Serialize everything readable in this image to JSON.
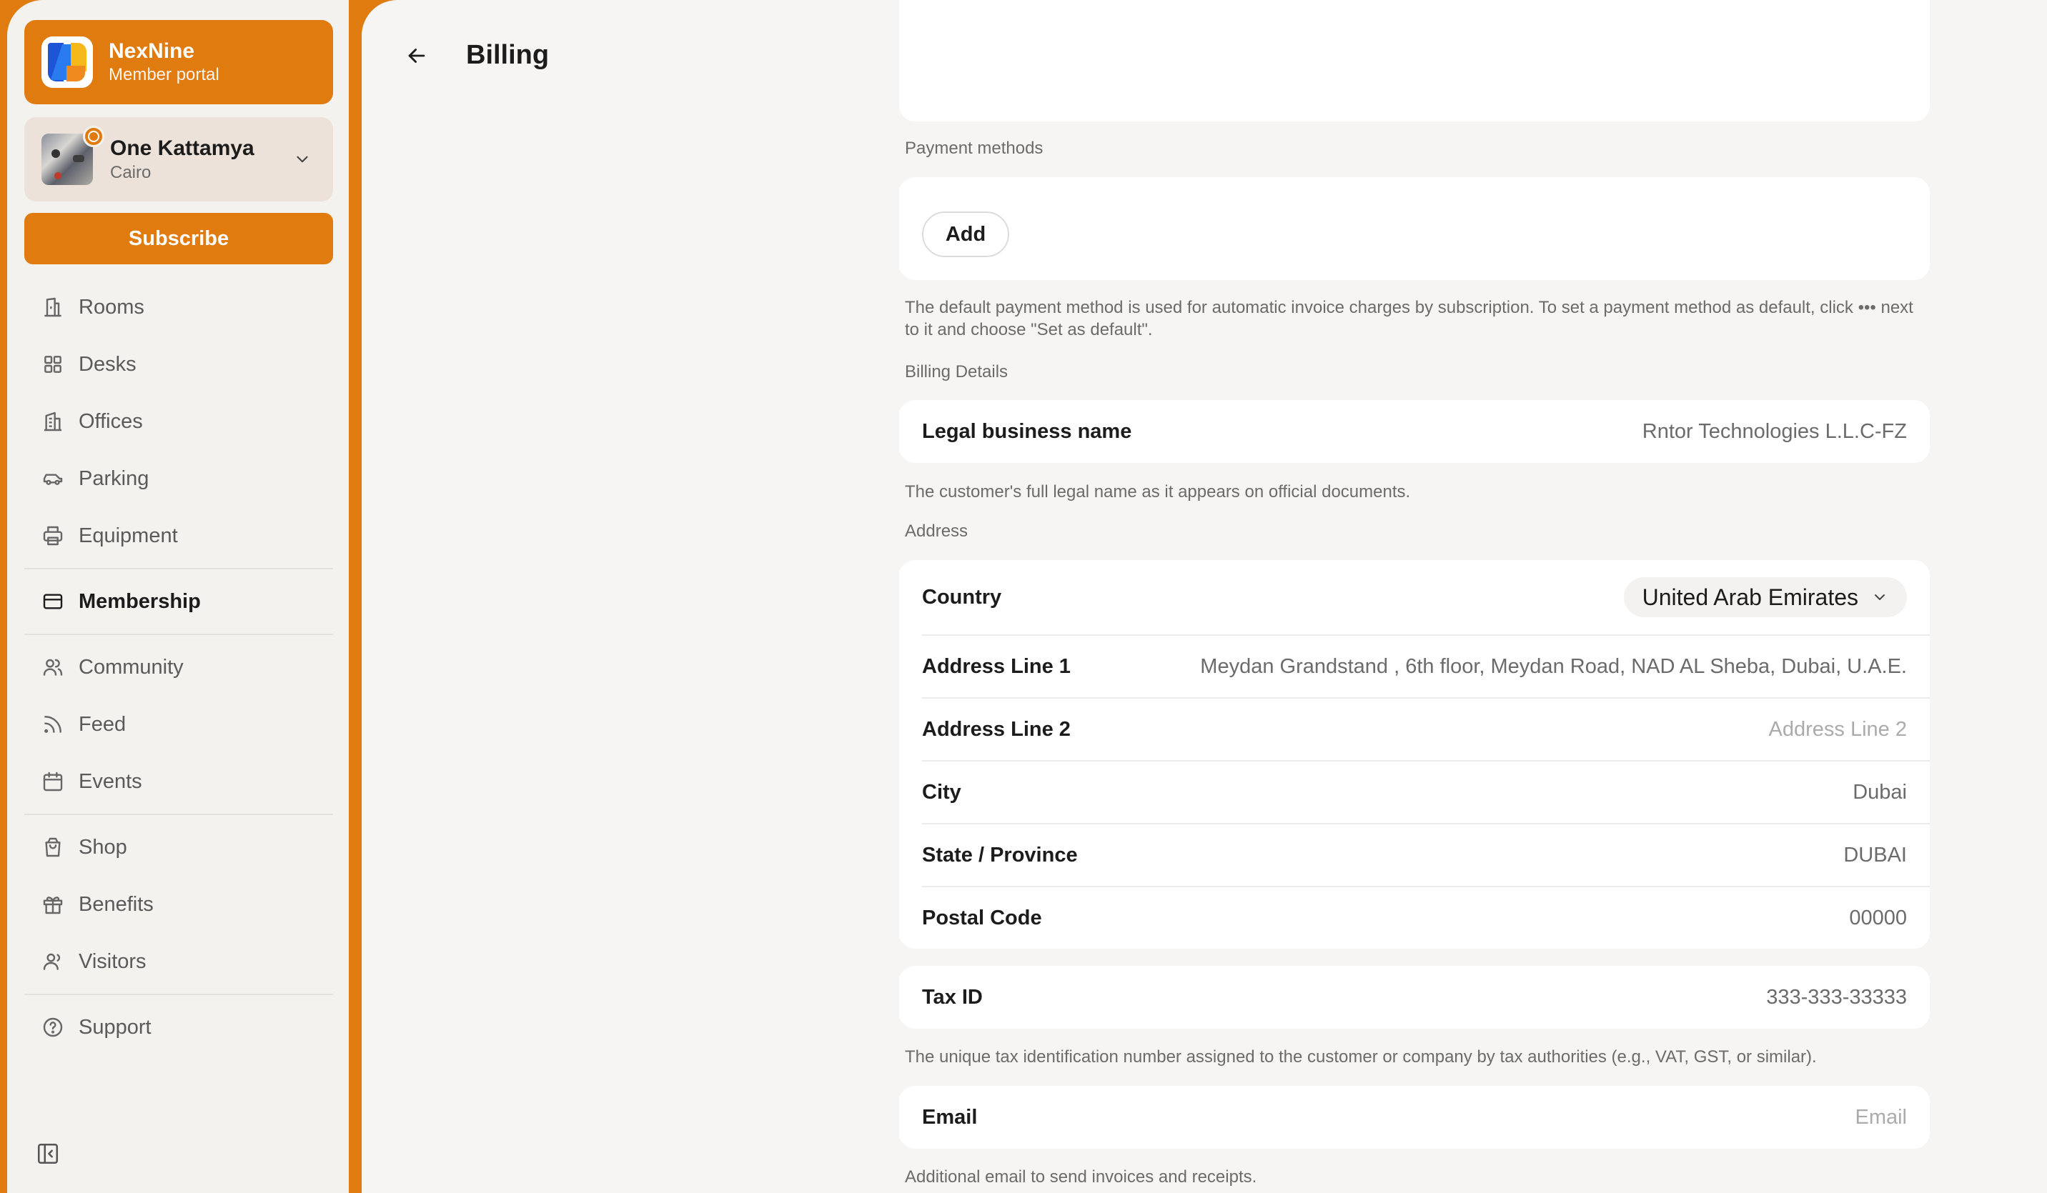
{
  "brand": {
    "name": "NexNine",
    "subtitle": "Member portal"
  },
  "location": {
    "name": "One Kattamya",
    "city": "Cairo"
  },
  "subscribe_label": "Subscribe",
  "nav": {
    "rooms": "Rooms",
    "desks": "Desks",
    "offices": "Offices",
    "parking": "Parking",
    "equipment": "Equipment",
    "membership": "Membership",
    "community": "Community",
    "feed": "Feed",
    "events": "Events",
    "shop": "Shop",
    "benefits": "Benefits",
    "visitors": "Visitors",
    "support": "Support"
  },
  "page": {
    "title": "Billing"
  },
  "payment": {
    "section_label": "Payment methods",
    "add_label": "Add",
    "help": "The default payment method is used for automatic invoice charges by subscription. To set a payment method as default, click ••• next to it and choose \"Set as default\"."
  },
  "billing": {
    "section_label": "Billing Details",
    "legal_label": "Legal business name",
    "legal_value": "Rntor Technologies L.L.C-FZ",
    "legal_help": "The customer's full legal name as it appears on official documents."
  },
  "address": {
    "section_label": "Address",
    "country_label": "Country",
    "country_value": "United Arab Emirates",
    "line1_label": "Address Line 1",
    "line1_value": "Meydan Grandstand , 6th floor, Meydan Road, NAD AL Sheba, Dubai, U.A.E.",
    "line2_label": "Address Line 2",
    "line2_placeholder": "Address Line 2",
    "city_label": "City",
    "city_value": "Dubai",
    "state_label": "State / Province",
    "state_value": "DUBAI",
    "postal_label": "Postal Code",
    "postal_value": "00000"
  },
  "tax": {
    "label": "Tax ID",
    "value": "333-333-33333",
    "help": "The unique tax identification number assigned to the customer or company by tax authorities (e.g., VAT, GST, or similar)."
  },
  "email": {
    "label": "Email",
    "placeholder": "Email",
    "help": "Additional email to send invoices and receipts."
  },
  "colors": {
    "accent": "#e07b10",
    "sidebar_bg": "#f4f2ef",
    "main_bg": "#f6f5f4"
  },
  "icons": [
    "building-icon",
    "grid-icon",
    "office-icon",
    "car-icon",
    "printer-icon",
    "card-icon",
    "users-icon",
    "rss-icon",
    "calendar-icon",
    "bag-icon",
    "gift-icon",
    "visitor-icon",
    "help-icon",
    "collapse-icon",
    "back-arrow-icon",
    "chevron-down-icon"
  ]
}
